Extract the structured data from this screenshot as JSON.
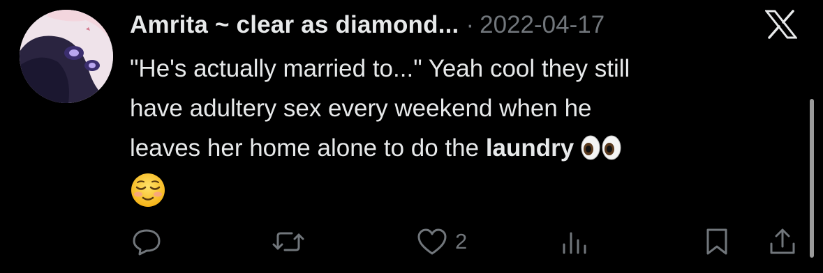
{
  "tweet": {
    "display_name": "Amrita ~ clear as diamond...",
    "separator": "·",
    "date": "2022-04-17",
    "text_lines": [
      "\"He's actually married to...\" Yeah cool they still",
      "have adultery sex every weekend when he",
      "leaves her home alone to do the"
    ],
    "bold_word": "laundry",
    "emojis": [
      "eyes-emoji",
      "relieved-face-emoji"
    ]
  },
  "actions": {
    "reply_icon": "reply-icon",
    "retweet_icon": "retweet-icon",
    "like_icon": "heart-icon",
    "like_count": "2",
    "views_icon": "views-icon",
    "bookmark_icon": "bookmark-icon",
    "share_icon": "share-icon"
  },
  "colors": {
    "background": "#000000",
    "text": "#e7e9ea",
    "muted": "#71767b"
  }
}
